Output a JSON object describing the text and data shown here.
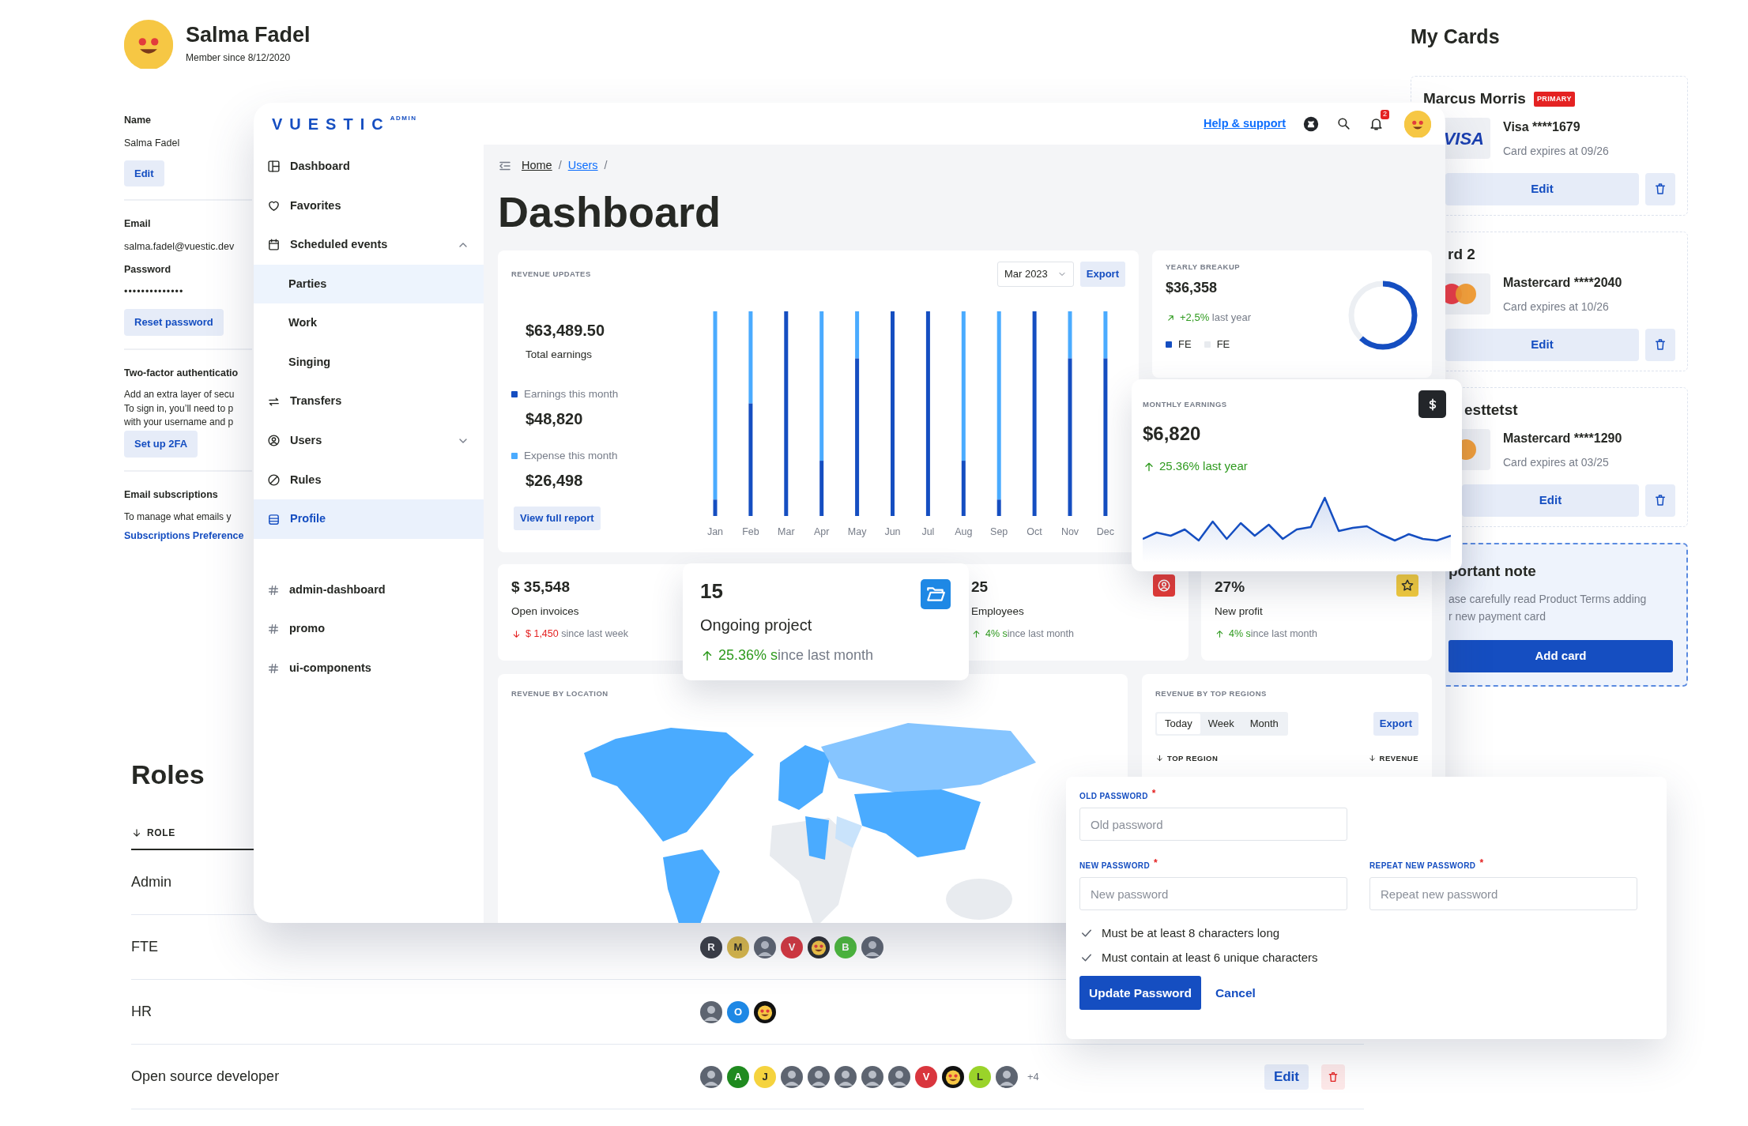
{
  "profile": {
    "name": "Salma Fadel",
    "member_since": "Member since 8/12/2020",
    "sections": [
      {
        "lines": [
          {
            "kind": "label",
            "text": "Name"
          },
          {
            "kind": "value",
            "text": "Salma Fadel"
          },
          {
            "kind": "button",
            "text": "Edit"
          }
        ]
      },
      {
        "lines": [
          {
            "kind": "label",
            "text": "Email"
          },
          {
            "kind": "value",
            "text": "salma.fadel@vuestic.dev"
          },
          {
            "kind": "label",
            "text": "Password"
          },
          {
            "kind": "secret",
            "text": "••••••••••••••"
          },
          {
            "kind": "button",
            "text": "Reset password"
          }
        ]
      },
      {
        "lines": [
          {
            "kind": "label",
            "text": "Two-factor authenticatio"
          },
          {
            "kind": "text",
            "text": "Add an extra layer of secu"
          },
          {
            "kind": "text",
            "text": "To sign in, you’ll need to p"
          },
          {
            "kind": "text",
            "text": "with your username and p"
          },
          {
            "kind": "button",
            "text": "Set up 2FA"
          }
        ]
      },
      {
        "lines": [
          {
            "kind": "label",
            "text": "Email subscriptions"
          },
          {
            "kind": "text",
            "text": "To manage what emails y"
          },
          {
            "kind": "link",
            "text": "Subscriptions Preference"
          }
        ]
      }
    ]
  },
  "roles": {
    "title": "Roles",
    "column": "ROLE",
    "rows": [
      {
        "role": "Admin"
      },
      {
        "role": "FTE",
        "members": [
          {
            "kind": "letter",
            "text": "R",
            "color": "#3a3d44"
          },
          {
            "kind": "letter",
            "text": "M",
            "color": "#d9b84a"
          },
          {
            "kind": "photo"
          },
          {
            "kind": "letter",
            "text": "V",
            "color": "#d9363e"
          },
          {
            "kind": "emoji",
            "color": "#2a2c30"
          },
          {
            "kind": "letter",
            "text": "B",
            "color": "#4cbb3a"
          },
          {
            "kind": "photo"
          }
        ]
      },
      {
        "role": "HR",
        "members": [
          {
            "kind": "photo"
          },
          {
            "kind": "letter",
            "text": "O",
            "color": "#1e88e5"
          },
          {
            "kind": "emoji",
            "color": "#111111"
          }
        ]
      },
      {
        "role": "Open source developer",
        "members": [
          {
            "kind": "photo"
          },
          {
            "kind": "letter",
            "text": "A",
            "color": "#1f8a1f"
          },
          {
            "kind": "letter",
            "text": "J",
            "color": "#f5d33e"
          },
          {
            "kind": "photo"
          },
          {
            "kind": "photo"
          },
          {
            "kind": "photo"
          },
          {
            "kind": "photo"
          },
          {
            "kind": "photo"
          },
          {
            "kind": "letter",
            "text": "V",
            "color": "#d9363e"
          },
          {
            "kind": "emoji",
            "color": "#111111"
          },
          {
            "kind": "letter",
            "text": "L",
            "color": "#9ad32a"
          },
          {
            "kind": "photo"
          }
        ],
        "more": "+4",
        "edit": "Edit"
      }
    ]
  },
  "admin": {
    "logo": "VUESTIC",
    "logo_badge": "ADMIN",
    "help": "Help & support",
    "notifications": "2",
    "sidebar": {
      "items": [
        {
          "label": "Dashboard",
          "selected": false,
          "hovered": false
        },
        {
          "label": "Favorites",
          "selected": false,
          "hovered": false
        },
        {
          "label": "Scheduled events",
          "selected": false,
          "hovered": false,
          "expanded": true,
          "children": [
            {
              "label": "Parties",
              "selected": false,
              "hovered": true
            },
            {
              "label": "Work",
              "selected": false,
              "hovered": false
            },
            {
              "label": "Singing",
              "selected": false,
              "hovered": false
            }
          ]
        },
        {
          "label": "Transfers",
          "selected": false,
          "hovered": false
        },
        {
          "label": "Users",
          "selected": false,
          "hovered": false,
          "expanded": false
        },
        {
          "label": "Rules",
          "selected": false,
          "hovered": false
        },
        {
          "label": "Profile",
          "selected": true,
          "hovered": false
        }
      ],
      "channels": [
        "admin-dashboard",
        "promo",
        "ui-components"
      ]
    },
    "breadcrumb": [
      "Home",
      "Users"
    ],
    "separator": "/",
    "title": "Dashboard",
    "revenue": {
      "title": "REVENUE UPDATES",
      "month": "Mar 2023",
      "export": "Export",
      "total": "$63,489.50",
      "total_label": "Total earnings",
      "amounts": [
        "$48,820",
        "$26,498"
      ],
      "report": "View full report",
      "legend": [
        {
          "label": "Earnings this month",
          "color": "#154ec1"
        },
        {
          "label": "Expense this month",
          "color": "#4aabff"
        }
      ],
      "months": [
        "Jan",
        "Feb",
        "Mar",
        "Apr",
        "May",
        "Jun",
        "Jul",
        "Aug",
        "Sep",
        "Oct",
        "Nov",
        "Dec"
      ]
    },
    "yearly": {
      "title": "YEARLY BREAKUP",
      "value": "$36,358",
      "change": "+2,5%",
      "suffix": "last year",
      "level": 0.62,
      "legend": [
        {
          "label": "FE",
          "color": "#154ec1"
        },
        {
          "label": "FE",
          "color": "#e8ebef"
        }
      ]
    },
    "monthly": {
      "title": "MONTHLY EARNINGS",
      "value": "$6,820",
      "change": "25.36%",
      "suffix": "last year"
    },
    "stats": [
      {
        "value": "$ 35,548",
        "label": "Open invoices",
        "change": "$ 1,450",
        "suffix": " since last week",
        "rising": false,
        "lifted": false
      },
      {
        "value": "15",
        "label": "Ongoing project",
        "change": "25.36% s",
        "suffix": "ince last month",
        "rising": true,
        "lifted": true,
        "color": "#1e88e5"
      },
      {
        "value": "25",
        "label": "Employees",
        "change": "4% s",
        "suffix": "ince last month",
        "rising": true,
        "lifted": false,
        "color": "#e53935"
      },
      {
        "value": "27%",
        "label": "New profit",
        "change": "4% s",
        "suffix": "ince last month",
        "rising": true,
        "lifted": false,
        "color": "#f5cd3c"
      }
    ],
    "location": {
      "title": "REVENUE BY LOCATION"
    },
    "regions": {
      "title": "REVENUE BY TOP REGIONS",
      "tabs": [
        {
          "label": "Today",
          "selected": true
        },
        {
          "label": "Week",
          "selected": false
        },
        {
          "label": "Month",
          "selected": false
        }
      ],
      "export": "Export",
      "columns": [
        "TOP REGION",
        "REVENUE"
      ]
    }
  },
  "password_form": {
    "fields": [
      {
        "label": "OLD PASSWORD",
        "mark": "*",
        "placeholder": "Old password"
      },
      {
        "label": "NEW PASSWORD",
        "mark": "*",
        "placeholder": "New password"
      },
      {
        "label": "REPEAT NEW PASSWORD",
        "mark": "*",
        "placeholder": "Repeat new password"
      }
    ],
    "rules": [
      {
        "text": "Must be at least 8 characters long",
        "checked": true
      },
      {
        "text": "Must contain at least 6 unique characters",
        "checked": true
      }
    ],
    "submit": "Update Password",
    "cancel": "Cancel"
  },
  "my_cards": {
    "title": "My Cards",
    "cards": [
      {
        "holder": "Marcus Morris",
        "badge": "PRIMARY",
        "kind": "visa",
        "logo": "VISA",
        "number": "Visa ****1679",
        "expires": "Card expires at 09/26",
        "edit": "Edit"
      },
      {
        "holder": "rd 2",
        "kind": "mastercard",
        "number": "Mastercard ****2040",
        "expires": "Card expires at 10/26",
        "edit": "Edit"
      },
      {
        "holder": "esttetst",
        "kind": "mastercard",
        "number": "Mastercard ****1290",
        "expires": "Card expires at 03/25",
        "edit": "Edit"
      }
    ],
    "note": {
      "title": "portant note",
      "before": "ase carefully read ",
      "link": "Product Terms",
      "after": " adding",
      "line2": "r new payment card",
      "button": "Add card"
    }
  }
}
